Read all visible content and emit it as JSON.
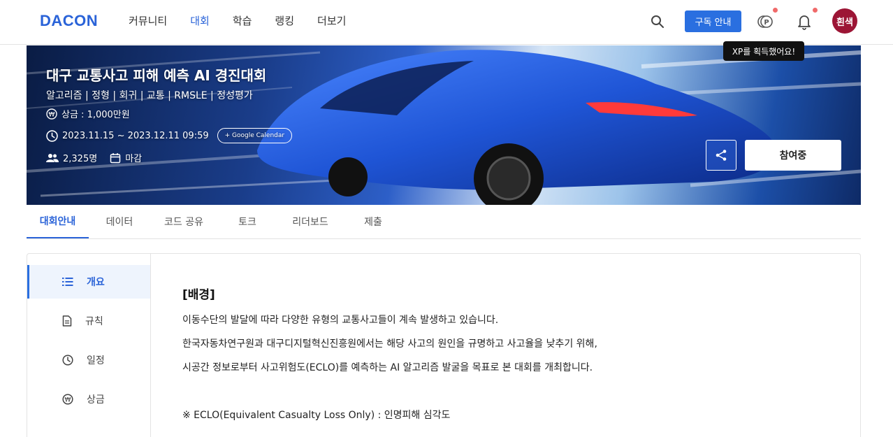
{
  "header": {
    "logo": "DACON",
    "nav": [
      "커뮤니티",
      "대회",
      "학습",
      "랭킹",
      "더보기"
    ],
    "nav_active_index": 1,
    "subscribe_label": "구독 안내",
    "avatar_text": "흰색",
    "xp_tooltip": "XP를 획득했어요!",
    "icons": [
      "search-icon",
      "point-icon",
      "bell-icon"
    ]
  },
  "banner": {
    "title": "대구 교통사고 피해 예측 AI 경진대회",
    "tags": "알고리즘 | 정형 | 회귀 | 교통 | RMSLE | 정성평가",
    "prize": "상금 : 1,000만원",
    "period": "2023.11.15 ~ 2023.12.11 09:59",
    "calendar_label": "+ Google Calendar",
    "participants": "2,325명",
    "status": "마감",
    "join_label": "참여중"
  },
  "tabs": [
    "대회안내",
    "데이터",
    "코드 공유",
    "토크",
    "리더보드",
    "제출"
  ],
  "tabs_active_index": 0,
  "sidebar": {
    "items": [
      {
        "label": "개요",
        "icon": "list-icon"
      },
      {
        "label": "규칙",
        "icon": "document-icon"
      },
      {
        "label": "일정",
        "icon": "clock-icon"
      },
      {
        "label": "상금",
        "icon": "won-icon"
      }
    ],
    "active_index": 0
  },
  "content": {
    "section_title": "[배경]",
    "paragraphs": [
      "이동수단의 발달에 따라 다양한 유형의 교통사고들이 계속 발생하고 있습니다.",
      "한국자동차연구원과 대구디지털혁신진흥원에서는 해당 사고의 원인을 규명하고 사고율을 낮추기 위해,",
      "시공간 정보로부터 사고위험도(ECLO)를 예측하는 AI 알고리즘 발굴을 목표로 본 대회를 개최합니다."
    ],
    "note": "※ ECLO(Equivalent Casualty Loss Only) : 인명피해 심각도"
  },
  "colors": {
    "accent": "#2a63d8",
    "subscribe_bg": "#2a6fe0",
    "avatar_bg": "#9c1535",
    "notification_dot": "#f06a6a"
  }
}
